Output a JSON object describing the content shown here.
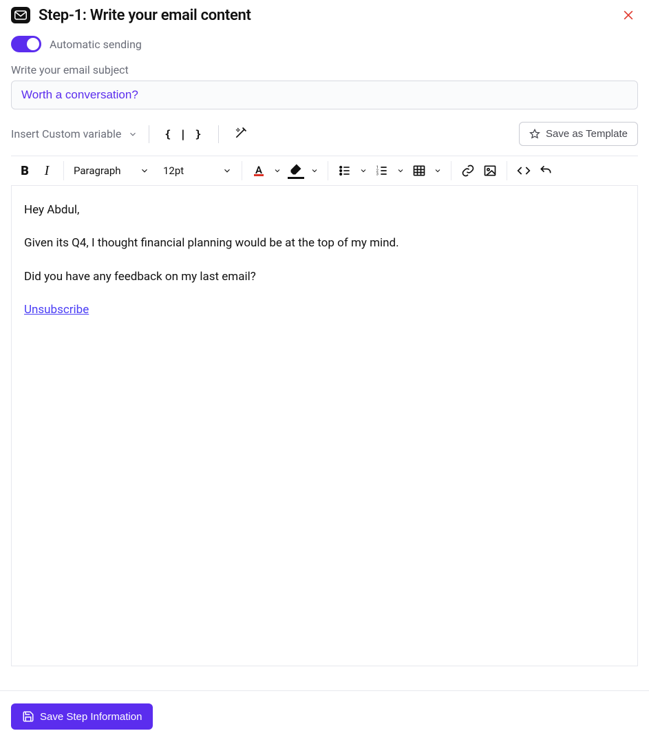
{
  "header": {
    "title": "Step-1:  Write your email content"
  },
  "toggle": {
    "label": "Automatic sending"
  },
  "subject": {
    "label": "Write your email subject",
    "value": "Worth a conversation?"
  },
  "subtoolbar": {
    "insert_custom_variable": "Insert Custom variable",
    "braces": "{ | }",
    "save_template": "Save as Template"
  },
  "editor_toolbar": {
    "paragraph": "Paragraph",
    "font_size": "12pt"
  },
  "body": {
    "greeting": "Hey Abdul,",
    "line1": "Given its Q4, I thought financial planning would be at the top of my mind.",
    "line2": "Did you have any feedback on my last email?",
    "unsubscribe": "Unsubscribe"
  },
  "footer": {
    "save_step": "Save Step Information"
  }
}
